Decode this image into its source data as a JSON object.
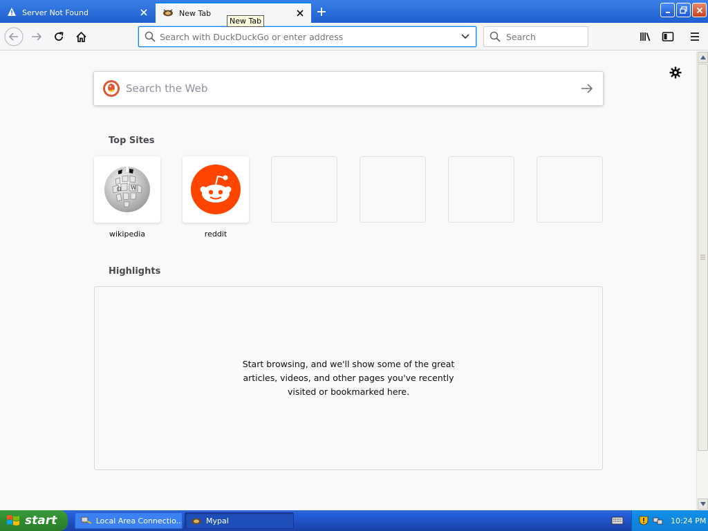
{
  "tabs": [
    {
      "title": "Server Not Found",
      "icon": "warning-icon",
      "active": false
    },
    {
      "title": "New Tab",
      "icon": "mypal-icon",
      "active": true
    }
  ],
  "tooltip": "New Tab",
  "toolbar": {
    "url_placeholder": "Search with DuckDuckGo or enter address",
    "search_placeholder": "Search"
  },
  "newtab": {
    "websearch_placeholder": "Search the Web",
    "top_sites_title": "Top Sites",
    "top_sites": [
      {
        "label": "wikipedia"
      },
      {
        "label": "reddit"
      },
      {
        "label": ""
      },
      {
        "label": ""
      },
      {
        "label": ""
      },
      {
        "label": ""
      }
    ],
    "highlights_title": "Highlights",
    "highlights_empty": "Start browsing, and we'll show some of the great articles, videos, and other pages you've recently visited or bookmarked here."
  },
  "taskbar": {
    "start_label": "start",
    "items": [
      {
        "label": "Local Area Connectio...",
        "active": false
      },
      {
        "label": "Mypal",
        "active": true
      }
    ],
    "clock": "10:24 PM"
  },
  "colors": {
    "accent": "#0a84ff",
    "reddit": "#ff4500"
  }
}
